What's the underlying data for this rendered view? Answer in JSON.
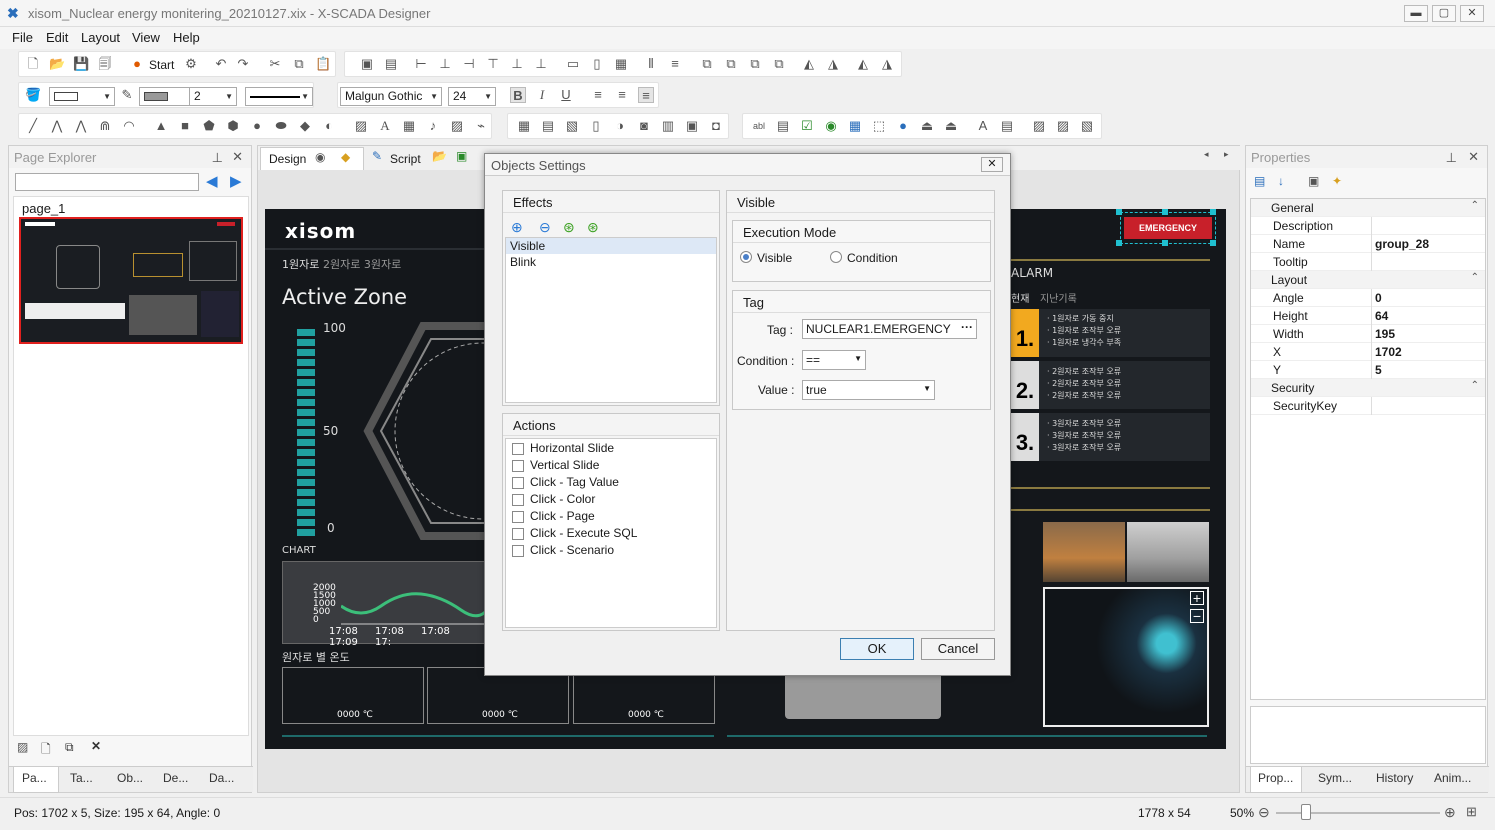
{
  "window": {
    "title": "xisom_Nuclear energy monitering_20210127.xix - X-SCADA Designer",
    "btn_min": "▬",
    "btn_max": "▢",
    "btn_close": "✕"
  },
  "menu": [
    "File",
    "Edit",
    "Layout",
    "View",
    "Help"
  ],
  "toolbar": {
    "start_label": "Start",
    "font_family": "Malgun Gothic",
    "font_size": "24",
    "line_width": "2",
    "bold": "B",
    "italic": "I",
    "underline": "U"
  },
  "page_explorer": {
    "title": "Page Explorer",
    "search_value": "",
    "page_name": "page_1",
    "bottom_tabs": [
      "Pa...",
      "Ta...",
      "Ob...",
      "De...",
      "Da..."
    ]
  },
  "doc_tabs": {
    "design": "Design",
    "script": "Script"
  },
  "canvas": {
    "logo": "xisom",
    "emergency": "EMERGENCY",
    "reactor_tabs_active": "1원자로",
    "reactor_tabs_rest": "2원자로 3원자로",
    "active_zone": "Active Zone",
    "gauge_max": "100",
    "gauge_mid": "50",
    "gauge_min": "0",
    "chart_label": "CHART",
    "chart_yticks": [
      "2000",
      "1500",
      "1000",
      "500",
      "0"
    ],
    "chart_xticks": [
      "17:08",
      "17:08",
      "17:08",
      "17:09",
      "17:"
    ],
    "temp_label": "원자로 별 온도",
    "temps": [
      "0000 ℃",
      "0000 ℃",
      "0000 ℃"
    ],
    "alarm_title": "ALARM",
    "alarm_tab_current": "현재",
    "alarm_tab_history": "지난기록",
    "alarms": [
      {
        "num": "1.",
        "lines": [
          "· 1원자로 가동 중지",
          "· 1원자로 조작부 오류",
          "· 1원자로 냉각수 부족"
        ]
      },
      {
        "num": "2.",
        "lines": [
          "· 2원자로 조작부 오류",
          "· 2원자로 조작부 오류",
          "· 2원자로 조작부 오류"
        ]
      },
      {
        "num": "3.",
        "lines": [
          "· 3원자로 조작부 오류",
          "· 3원자로 조작부 오류",
          "· 3원자로 조작부 오류"
        ]
      }
    ]
  },
  "dialog": {
    "title": "Objects Settings",
    "effects_header": "Effects",
    "effects": [
      "Visible",
      "Blink"
    ],
    "selected_effect": "Visible",
    "actions_header": "Actions",
    "actions": [
      "Horizontal Slide",
      "Vertical Slide",
      "Click - Tag Value",
      "Click - Color",
      "Click - Page",
      "Click - Execute SQL",
      "Click - Scenario"
    ],
    "right_header": "Visible",
    "exec_mode_header": "Execution Mode",
    "exec_mode_options": [
      "Visible",
      "Condition"
    ],
    "exec_mode_selected": "Visible",
    "tag_header": "Tag",
    "tag_label": "Tag :",
    "tag_value": "NUCLEAR1.EMERGENCY",
    "tag_browse": "···",
    "condition_label": "Condition :",
    "condition_value": "==",
    "value_label": "Value :",
    "value_value": "true",
    "ok": "OK",
    "cancel": "Cancel"
  },
  "properties": {
    "title": "Properties",
    "rows": [
      {
        "cat": true,
        "k": "General"
      },
      {
        "k": "Description",
        "v": ""
      },
      {
        "k": "Name",
        "v": "group_28"
      },
      {
        "k": "Tooltip",
        "v": ""
      },
      {
        "cat": true,
        "k": "Layout"
      },
      {
        "k": "Angle",
        "v": "0"
      },
      {
        "k": "Height",
        "v": "64"
      },
      {
        "k": "Width",
        "v": "195"
      },
      {
        "k": "X",
        "v": "1702"
      },
      {
        "k": "Y",
        "v": "5"
      },
      {
        "cat": true,
        "k": "Security"
      },
      {
        "k": "SecurityKey",
        "v": ""
      }
    ],
    "bottom_tabs": [
      "Prop...",
      "Sym...",
      "History",
      "Anim..."
    ]
  },
  "status": {
    "pos": "Pos: 1702 x 5, Size: 195 x 64, Angle: 0",
    "canvas_size": "1778 x 54",
    "zoom": "50%"
  }
}
